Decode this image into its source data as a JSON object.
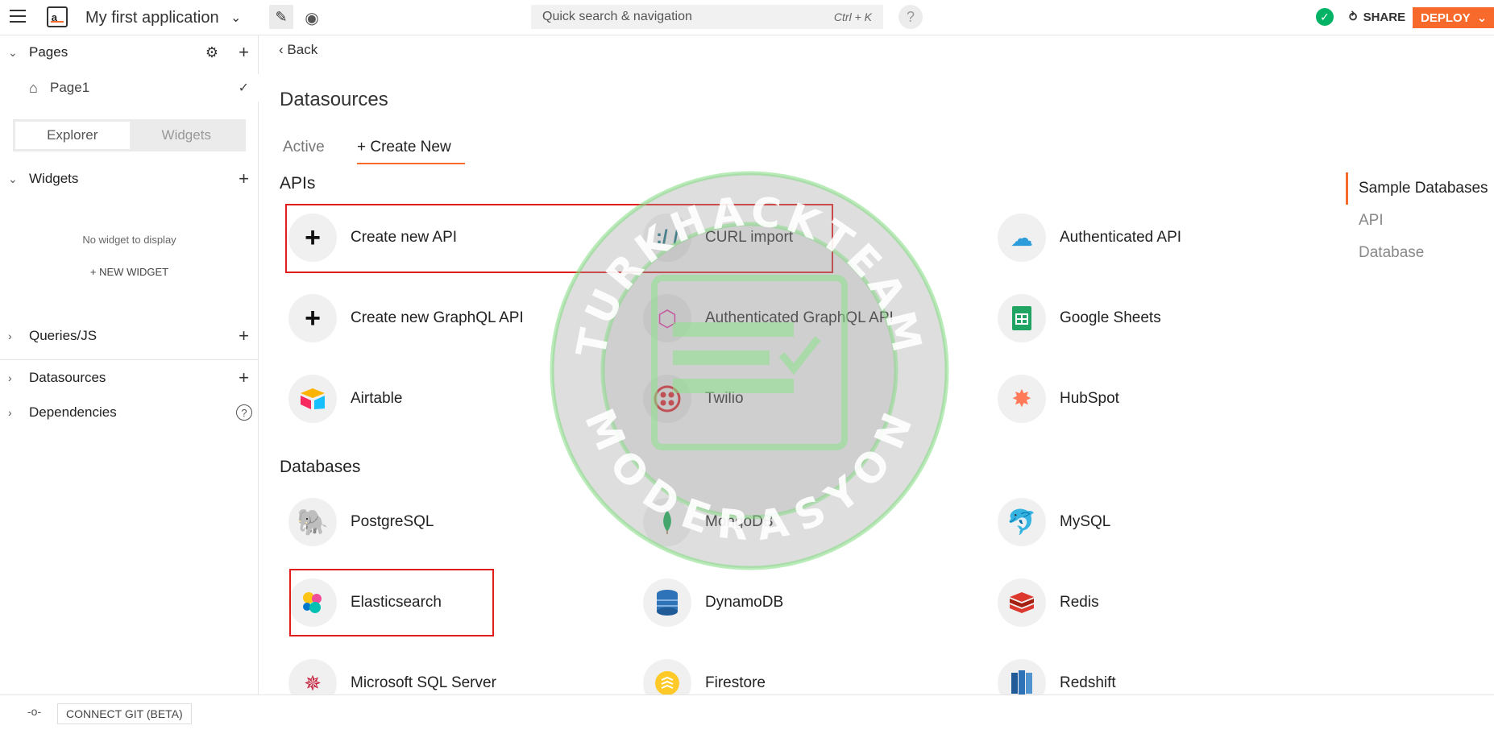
{
  "app": {
    "logo_text": "a_",
    "name": "My first application",
    "search_placeholder": "Quick search & navigation",
    "search_shortcut": "Ctrl + K",
    "help": "?",
    "share_label": "SHARE",
    "deploy_label": "DEPLOY"
  },
  "sidebar": {
    "pages_title": "Pages",
    "page_item": "Page1",
    "explorer_tab": "Explorer",
    "widgets_tab": "Widgets",
    "widgets_title": "Widgets",
    "no_widget": "No widget to display",
    "new_widget": "+ NEW WIDGET",
    "queries_title": "Queries/JS",
    "datasources_title": "Datasources",
    "dependencies_title": "Dependencies"
  },
  "main": {
    "back": "Back",
    "title": "Datasources",
    "tab_active": "Active",
    "tab_create": "+ Create New",
    "apis_title": "APIs",
    "databases_title": "Databases",
    "apis": [
      {
        "label": "Create new API",
        "icon": "plus-icon"
      },
      {
        "label": "CURL import",
        "icon": "curl-icon"
      },
      {
        "label": "Authenticated API",
        "icon": "cloud-icon"
      },
      {
        "label": "Create new GraphQL API",
        "icon": "plus-icon"
      },
      {
        "label": "Authenticated GraphQL API",
        "icon": "graphql-icon"
      },
      {
        "label": "Google Sheets",
        "icon": "google-sheets-icon"
      },
      {
        "label": "Airtable",
        "icon": "airtable-icon"
      },
      {
        "label": "Twilio",
        "icon": "twilio-icon"
      },
      {
        "label": "HubSpot",
        "icon": "hubspot-icon"
      }
    ],
    "databases": [
      {
        "label": "PostgreSQL",
        "icon": "postgresql-icon"
      },
      {
        "label": "MongoDB",
        "icon": "mongodb-icon"
      },
      {
        "label": "MySQL",
        "icon": "mysql-icon"
      },
      {
        "label": "Elasticsearch",
        "icon": "elasticsearch-icon"
      },
      {
        "label": "DynamoDB",
        "icon": "dynamodb-icon"
      },
      {
        "label": "Redis",
        "icon": "redis-icon"
      },
      {
        "label": "Microsoft SQL Server",
        "icon": "mssql-icon"
      },
      {
        "label": "Firestore",
        "icon": "firestore-icon"
      },
      {
        "label": "Redshift",
        "icon": "redshift-icon"
      }
    ]
  },
  "right_nav": {
    "items": [
      "Sample Databases",
      "API",
      "Database"
    ]
  },
  "footer": {
    "git_label": "CONNECT GIT (BETA)"
  },
  "watermark": {
    "top_text": "TURKHACKTEAM",
    "bottom_text": "MODERASYON"
  },
  "colors": {
    "accent": "#f86a2b",
    "success": "#03b365",
    "highlight": "#e21d1d"
  }
}
